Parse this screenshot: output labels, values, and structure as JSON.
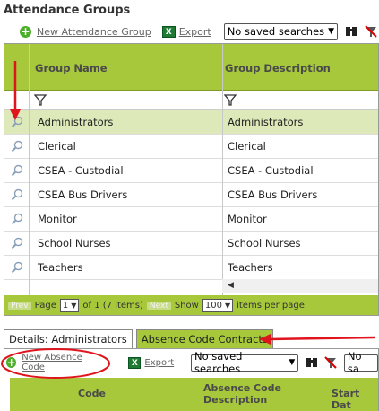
{
  "page_title": "Attendance Groups",
  "toolbar": {
    "new_label": "New Attendance Group",
    "export_label": "Export",
    "search_select": "No saved searches"
  },
  "grid": {
    "columns": [
      "Group Name",
      "Group Description"
    ],
    "rows": [
      {
        "name": "Administrators",
        "description": "Administrators",
        "selected": true
      },
      {
        "name": "Clerical",
        "description": "Clerical"
      },
      {
        "name": "CSEA - Custodial",
        "description": "CSEA - Custodial"
      },
      {
        "name": "CSEA Bus Drivers",
        "description": "CSEA Bus Drivers"
      },
      {
        "name": "Monitor",
        "description": "Monitor"
      },
      {
        "name": "School Nurses",
        "description": "School Nurses"
      },
      {
        "name": "Teachers",
        "description": "Teachers"
      }
    ]
  },
  "pager": {
    "prev_label": "Prev",
    "page_label": "Page",
    "page_value": "1",
    "of_text": "of 1 (7 items)",
    "next_label": "Next",
    "show_label": "Show",
    "show_value": "100",
    "per_page_text": "items per page."
  },
  "tabs": {
    "details_label": "Details: Administrators",
    "contracts_label": "Absence Code Contracts"
  },
  "sub": {
    "new_label": "New Absence Code",
    "export_label": "Export",
    "search_select": "No saved searches",
    "search_select_2": "No sa",
    "columns": [
      "Code",
      "Absence Code Description",
      "Start Dat"
    ]
  },
  "colors": {
    "header_green": "#a6c83a",
    "selected_row": "#dde9b8",
    "annotation_red": "#e0141c"
  }
}
